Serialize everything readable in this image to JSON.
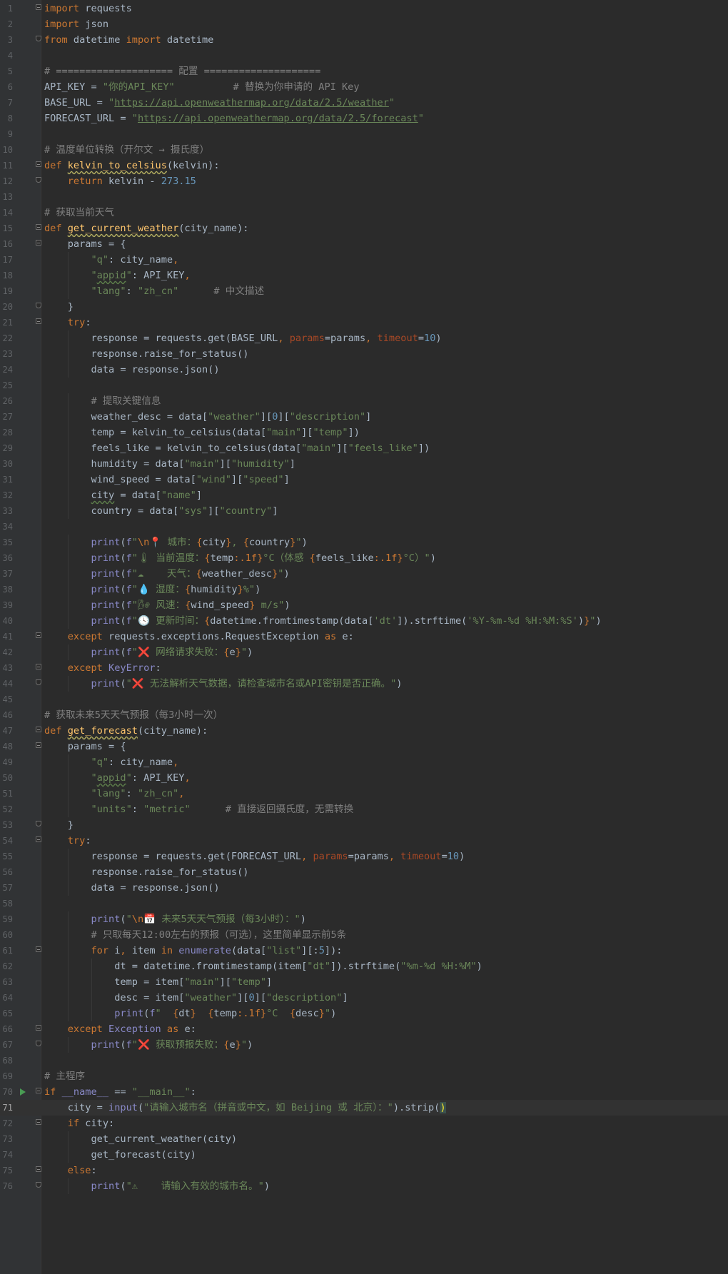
{
  "editor": {
    "current_line": 71,
    "lines": [
      {
        "n": "1",
        "t": "import requests"
      },
      {
        "n": "2",
        "t": "import json"
      },
      {
        "n": "3",
        "t": "from datetime import datetime"
      },
      {
        "n": "4",
        "t": ""
      },
      {
        "n": "5",
        "t": "# ==================== 配置 ===================="
      },
      {
        "n": "6",
        "t": "API_KEY = \"你的API_KEY\"          # 替换为你申请的 API Key"
      },
      {
        "n": "7",
        "t": "BASE_URL = \"https://api.openweathermap.org/data/2.5/weather\""
      },
      {
        "n": "8",
        "t": "FORECAST_URL = \"https://api.openweathermap.org/data/2.5/forecast\""
      },
      {
        "n": "9",
        "t": ""
      },
      {
        "n": "10",
        "t": "# 温度单位转换（开尔文 → 摄氏度）"
      },
      {
        "n": "11",
        "t": "def kelvin_to_celsius(kelvin):"
      },
      {
        "n": "12",
        "t": "    return kelvin - 273.15"
      },
      {
        "n": "13",
        "t": ""
      },
      {
        "n": "14",
        "t": "# 获取当前天气"
      },
      {
        "n": "15",
        "t": "def get_current_weather(city_name):"
      },
      {
        "n": "16",
        "t": "    params = {"
      },
      {
        "n": "17",
        "t": "        \"q\": city_name,"
      },
      {
        "n": "18",
        "t": "        \"appid\": API_KEY,"
      },
      {
        "n": "19",
        "t": "        \"lang\": \"zh_cn\"      # 中文描述"
      },
      {
        "n": "20",
        "t": "    }"
      },
      {
        "n": "21",
        "t": "    try:"
      },
      {
        "n": "22",
        "t": "        response = requests.get(BASE_URL, params=params, timeout=10)"
      },
      {
        "n": "23",
        "t": "        response.raise_for_status()"
      },
      {
        "n": "24",
        "t": "        data = response.json()"
      },
      {
        "n": "25",
        "t": ""
      },
      {
        "n": "26",
        "t": "        # 提取关键信息"
      },
      {
        "n": "27",
        "t": "        weather_desc = data[\"weather\"][0][\"description\"]"
      },
      {
        "n": "28",
        "t": "        temp = kelvin_to_celsius(data[\"main\"][\"temp\"])"
      },
      {
        "n": "29",
        "t": "        feels_like = kelvin_to_celsius(data[\"main\"][\"feels_like\"])"
      },
      {
        "n": "30",
        "t": "        humidity = data[\"main\"][\"humidity\"]"
      },
      {
        "n": "31",
        "t": "        wind_speed = data[\"wind\"][\"speed\"]"
      },
      {
        "n": "32",
        "t": "        city = data[\"name\"]"
      },
      {
        "n": "33",
        "t": "        country = data[\"sys\"][\"country\"]"
      },
      {
        "n": "34",
        "t": ""
      },
      {
        "n": "35",
        "t": "        print(f\"\\n📍 城市：{city}, {country}\")"
      },
      {
        "n": "36",
        "t": "        print(f\"🌡 当前温度：{temp:.1f}°C（体感 {feels_like:.1f}°C）\")"
      },
      {
        "n": "37",
        "t": "        print(f\"☁    天气：{weather_desc}\")"
      },
      {
        "n": "38",
        "t": "        print(f\"💧 湿度：{humidity}%\")"
      },
      {
        "n": "39",
        "t": "        print(f\"🌬 风速：{wind_speed} m/s\")"
      },
      {
        "n": "40",
        "t": "        print(f\"🕓 更新时间：{datetime.fromtimestamp(data['dt']).strftime('%Y-%m-%d %H:%M:%S')}\")"
      },
      {
        "n": "41",
        "t": "    except requests.exceptions.RequestException as e:"
      },
      {
        "n": "42",
        "t": "        print(f\"❌ 网络请求失败：{e}\")"
      },
      {
        "n": "43",
        "t": "    except KeyError:"
      },
      {
        "n": "44",
        "t": "        print(\"❌ 无法解析天气数据，请检查城市名或API密钥是否正确。\")"
      },
      {
        "n": "45",
        "t": ""
      },
      {
        "n": "46",
        "t": "# 获取未来5天天气预报（每3小时一次）"
      },
      {
        "n": "47",
        "t": "def get_forecast(city_name):"
      },
      {
        "n": "48",
        "t": "    params = {"
      },
      {
        "n": "49",
        "t": "        \"q\": city_name,"
      },
      {
        "n": "50",
        "t": "        \"appid\": API_KEY,"
      },
      {
        "n": "51",
        "t": "        \"lang\": \"zh_cn\","
      },
      {
        "n": "52",
        "t": "        \"units\": \"metric\"      # 直接返回摄氏度，无需转换"
      },
      {
        "n": "53",
        "t": "    }"
      },
      {
        "n": "54",
        "t": "    try:"
      },
      {
        "n": "55",
        "t": "        response = requests.get(FORECAST_URL, params=params, timeout=10)"
      },
      {
        "n": "56",
        "t": "        response.raise_for_status()"
      },
      {
        "n": "57",
        "t": "        data = response.json()"
      },
      {
        "n": "58",
        "t": ""
      },
      {
        "n": "59",
        "t": "        print(\"\\n📅 未来5天天气预报（每3小时）：\")"
      },
      {
        "n": "60",
        "t": "        # 只取每天12:00左右的预报（可选），这里简单显示前5条"
      },
      {
        "n": "61",
        "t": "        for i, item in enumerate(data[\"list\"][:5]):"
      },
      {
        "n": "62",
        "t": "            dt = datetime.fromtimestamp(item[\"dt\"]).strftime(\"%m-%d %H:%M\")"
      },
      {
        "n": "63",
        "t": "            temp = item[\"main\"][\"temp\"]"
      },
      {
        "n": "64",
        "t": "            desc = item[\"weather\"][0][\"description\"]"
      },
      {
        "n": "65",
        "t": "            print(f\"  {dt}  {temp:.1f}°C  {desc}\")"
      },
      {
        "n": "66",
        "t": "    except Exception as e:"
      },
      {
        "n": "67",
        "t": "        print(f\"❌ 获取预报失败：{e}\")"
      },
      {
        "n": "68",
        "t": ""
      },
      {
        "n": "69",
        "t": "# 主程序"
      },
      {
        "n": "70",
        "t": "if __name__ == \"__main__\":"
      },
      {
        "n": "71",
        "t": "    city = input(\"请输入城市名（拼音或中文，如 Beijing 或 北京）：\").strip()"
      },
      {
        "n": "72",
        "t": "    if city:"
      },
      {
        "n": "73",
        "t": "        get_current_weather(city)"
      },
      {
        "n": "74",
        "t": "        get_forecast(city)"
      },
      {
        "n": "75",
        "t": "    else:"
      },
      {
        "n": "76",
        "t": "        print(\"⚠    请输入有效的城市名。\")"
      }
    ]
  },
  "colors": {
    "background": "#2b2b2b",
    "gutter": "#313335",
    "keyword": "#cc7832",
    "string": "#6a8759",
    "comment": "#808080",
    "number": "#6897bb",
    "function": "#ffc66d",
    "builtin": "#8888c6",
    "param": "#aa4926",
    "text": "#a9b7c6"
  }
}
